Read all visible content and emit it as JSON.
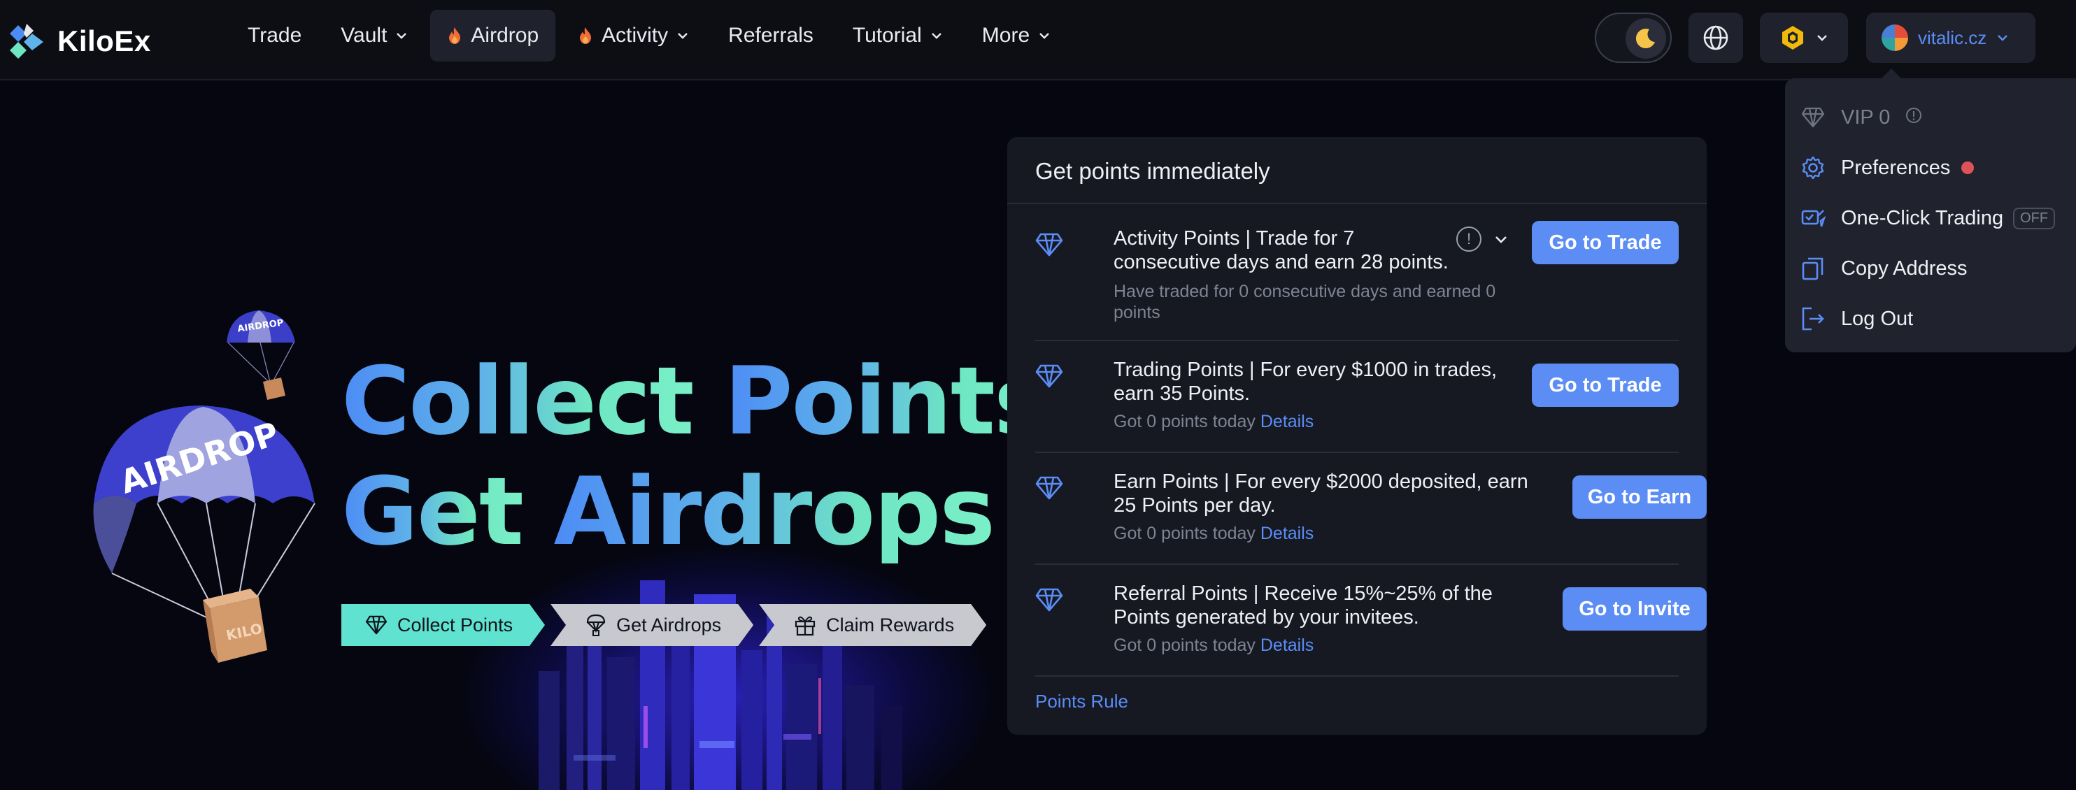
{
  "brand": {
    "name": "KiloEx"
  },
  "nav": {
    "items": [
      {
        "label": "Trade"
      },
      {
        "label": "Vault"
      },
      {
        "label": "Airdrop"
      },
      {
        "label": "Activity"
      },
      {
        "label": "Referrals"
      },
      {
        "label": "Tutorial"
      },
      {
        "label": "More"
      }
    ]
  },
  "header": {
    "username": "vitalic.cz"
  },
  "dropdown": {
    "vip": "VIP 0",
    "preferences": "Preferences",
    "one_click": "One-Click Trading",
    "one_click_state": "OFF",
    "copy_address": "Copy Address",
    "log_out": "Log Out"
  },
  "hero": {
    "line1_a": "Collect",
    "line1_b": "Points",
    "line2_a": "Get",
    "line2_b": "Airdrops",
    "steps": [
      "Collect Points",
      "Get Airdrops",
      "Claim Rewards"
    ],
    "parachute_text": "AIRDROP",
    "box_text": "KILO"
  },
  "card": {
    "title": "Get points immediately",
    "tasks": [
      {
        "title_line1": "Activity Points | Trade for 7",
        "title_line2": "consecutive days and earn 28 points.",
        "sub_line1": "Have traded for 0 consecutive days and earned 0",
        "sub_line2": "points",
        "button": "Go to Trade"
      },
      {
        "title_line1": "Trading Points | For every $1000 in trades,",
        "title_line2": "earn 35 Points.",
        "sub": "Got 0 points today",
        "link": "Details",
        "button": "Go to Trade"
      },
      {
        "title_line1": "Earn Points | For every $2000 deposited, earn",
        "title_line2": "25 Points per day.",
        "sub": "Got 0 points today",
        "link": "Details",
        "button": "Go to Earn"
      },
      {
        "title_line1": "Referral Points | Receive 15%~25% of the",
        "title_line2": "Points generated by your invitees.",
        "sub": "Got 0 points today",
        "link": "Details",
        "button": "Go to Invite"
      }
    ],
    "points_rule": "Points Rule"
  },
  "colors": {
    "accent": "#5b8df5",
    "teal": "#5fe2cf",
    "background": "#05060f",
    "card": "#161822"
  }
}
